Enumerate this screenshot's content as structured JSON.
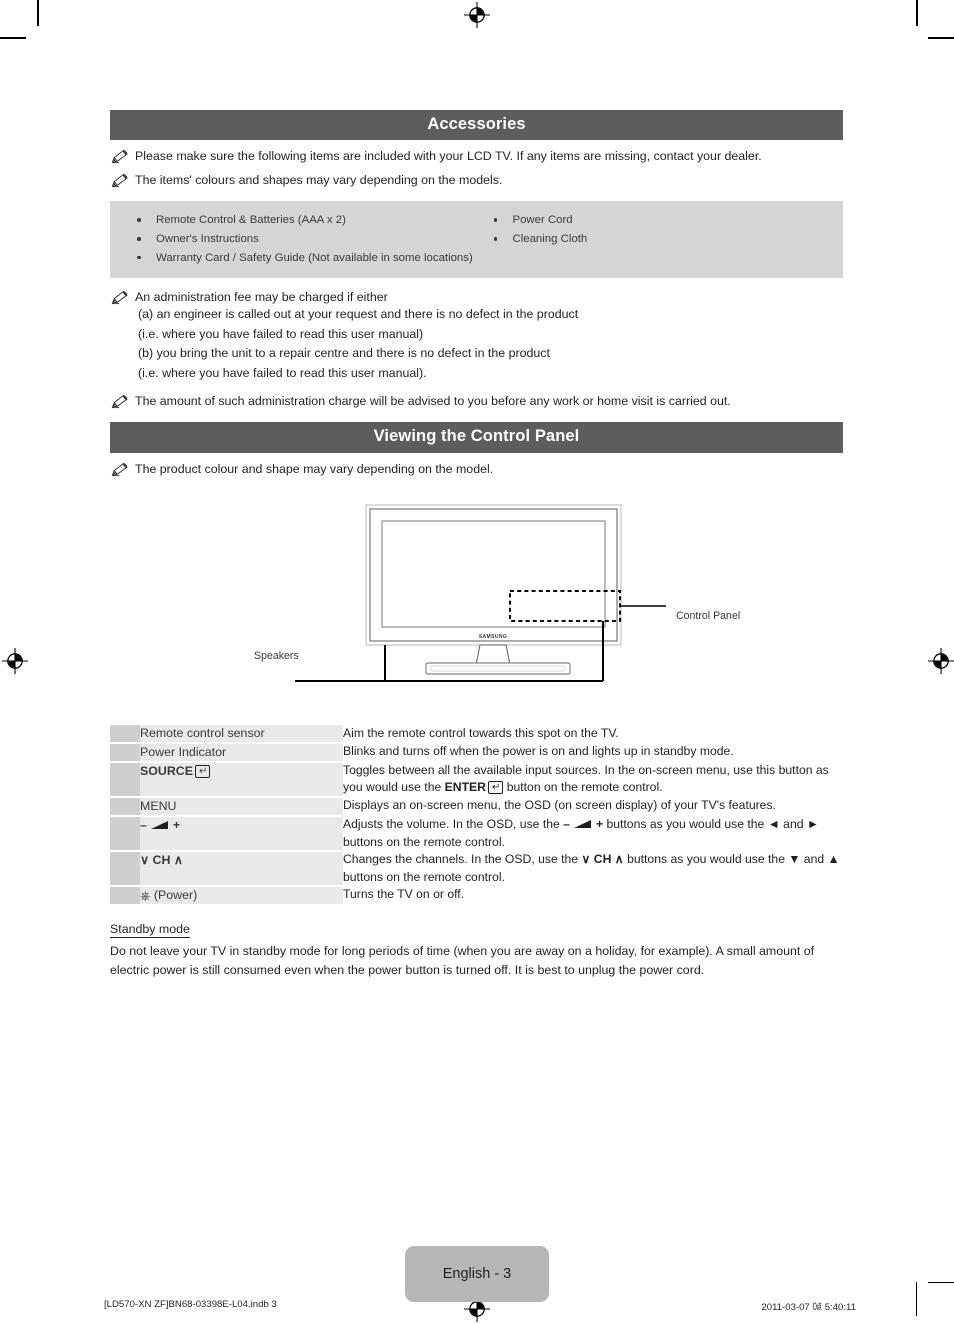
{
  "document": {
    "page_label": "English - 3",
    "footer_left": "[LD570-XN ZF]BN68-03398E-L04.indb   3",
    "footer_right": "2011-03-07   ㍘ 5:40:11"
  },
  "accessories_section": {
    "title": "Accessories",
    "notes": [
      "Please make sure the following items are included with your LCD TV. If any items are missing, contact your dealer.",
      "The items' colours and shapes may vary depending on the models."
    ],
    "items_left": [
      "Remote Control & Batteries (AAA x 2)",
      "Owner's Instructions",
      "Warranty Card / Safety Guide (Not available in some locations)"
    ],
    "items_right": [
      "Power Cord",
      "Cleaning Cloth"
    ],
    "fee_note": "An administration fee may be charged if either",
    "fee_lines": [
      "(a) an engineer is called out at your request and there is no defect in the product",
      "(i.e. where you have failed to read this user manual)",
      "(b) you bring the unit to a repair centre and there is no defect in the product",
      "(i.e. where you have failed to read this user manual)."
    ],
    "charge_note": "The amount of such administration charge will be advised to you before any work or home visit is carried out."
  },
  "control_panel_section": {
    "title": "Viewing the Control Panel",
    "note": "The product colour and shape may vary depending on the model.",
    "figure": {
      "control_panel_label": "Control Panel",
      "speakers_label": "Speakers",
      "brand": "SAMSUNG"
    },
    "table": [
      {
        "label": "Remote control sensor",
        "label_kind": "plain",
        "description": "Aim the remote control towards this spot on the TV."
      },
      {
        "label": "Power Indicator",
        "label_kind": "plain",
        "description": "Blinks and turns off when the power is on and lights up in standby mode."
      },
      {
        "label": "SOURCE",
        "label_kind": "source",
        "description_part1": "Toggles between all the available input sources. In the on-screen menu, use this button as you would use the ",
        "description_enter": "ENTER",
        "description_part2": " button on the remote control."
      },
      {
        "label": "MENU",
        "label_kind": "plain",
        "description": "Displays an on-screen menu, the OSD (on screen display) of your TV's features."
      },
      {
        "label_minus": "–",
        "label_plus": "+",
        "label_kind": "volume",
        "description_part1": "Adjusts the volume. In the OSD, use the ",
        "description_minus": "–",
        "description_plus": "+",
        "description_part2": " buttons as you would use the ◄ and ► buttons on the remote control."
      },
      {
        "label": "CH",
        "label_kind": "channel",
        "label_down": "∨",
        "label_up": "∧",
        "description_part1": "Changes the channels. In the OSD, use the ",
        "description_ch": "CH",
        "description_part2": " buttons as you would use the ▼ and ▲ buttons on the remote control."
      },
      {
        "label": "(Power)",
        "label_kind": "power",
        "description": "Turns the TV on or off."
      }
    ]
  },
  "standby_section": {
    "heading": "Standby mode",
    "body": "Do not leave your TV in standby mode for long periods of time (when you are away on a holiday, for example). A small amount of electric power is still consumed even when the power button is turned off. It is best to unplug the power cord."
  }
}
